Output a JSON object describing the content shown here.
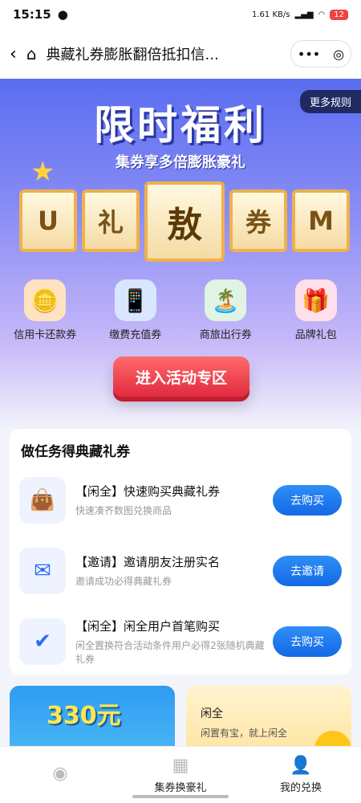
{
  "status": {
    "time": "15:15",
    "net": "1.61 KB/s",
    "battery": "12"
  },
  "nav": {
    "title": "典藏礼券膨胀翻倍抵扣信...",
    "more": "•••",
    "target": "◎"
  },
  "hero": {
    "rules": "更多规则",
    "title": "限时福利",
    "subtitle": "集券享多倍膨胀豪礼",
    "tiles": [
      "U",
      "礼",
      "敖",
      "券",
      "M"
    ],
    "categories": [
      {
        "label": "信用卡还款券",
        "icon": "🪙",
        "color": "#ffb35c"
      },
      {
        "label": "缴费充值券",
        "icon": "📱",
        "color": "#7aa9ff"
      },
      {
        "label": "商旅出行券",
        "icon": "🏝️",
        "color": "#7ed58f"
      },
      {
        "label": "品牌礼包",
        "icon": "🎁",
        "color": "#ff8aa8"
      }
    ],
    "cta": "进入活动专区"
  },
  "tasks": {
    "title": "做任务得典藏礼券",
    "items": [
      {
        "title": "【闲全】快速购买典藏礼券",
        "desc": "快速凑齐数图兑换商品",
        "btn": "去购买",
        "icon": "👜"
      },
      {
        "title": "【邀请】邀请朋友注册实名",
        "desc": "邀请成功必得典藏礼券",
        "btn": "去邀请",
        "icon": "✉"
      },
      {
        "title": "【闲全】闲全用户首笔购买",
        "desc": "闲全置换符合活动条件用户必得2张随机典藏礼券",
        "btn": "去购买",
        "icon": "✔"
      }
    ]
  },
  "promos": {
    "amount": "330元",
    "p2_title": "闲全",
    "p2_desc": "闲置有宝，就上闲全"
  },
  "tabbar": [
    {
      "label": "",
      "icon": "◉"
    },
    {
      "label": "集券换豪礼",
      "icon": "▦"
    },
    {
      "label": "我的兑换",
      "icon": "👤"
    }
  ]
}
